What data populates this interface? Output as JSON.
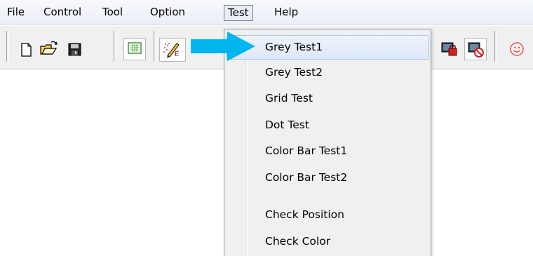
{
  "menubar": {
    "items": [
      {
        "label": "File"
      },
      {
        "label": "Control"
      },
      {
        "label": "Tool"
      },
      {
        "label": "Option"
      },
      {
        "label": "Test"
      },
      {
        "label": "Help"
      }
    ],
    "active": "Test"
  },
  "toolbar": {
    "buttons": [
      {
        "icon": "new-document-icon"
      },
      {
        "icon": "open-folder-icon"
      },
      {
        "icon": "save-disk-icon"
      },
      {
        "icon": "grid-screen-icon"
      },
      {
        "icon": "edit-pencil-icon"
      },
      {
        "icon": "monitor-lock-icon"
      },
      {
        "icon": "monitor-no-icon"
      },
      {
        "icon": "smiley-icon"
      }
    ]
  },
  "test_menu": {
    "items": [
      {
        "label": "Grey Test1",
        "highlighted": true
      },
      {
        "label": "Grey Test2"
      },
      {
        "label": "Grid Test"
      },
      {
        "label": "Dot Test"
      },
      {
        "label": "Color Bar Test1"
      },
      {
        "label": "Color Bar Test2"
      },
      {
        "label": "Check Position"
      },
      {
        "label": "Check Color"
      }
    ]
  },
  "annotation": {
    "icon": "pointer-arrow-icon",
    "color": "#00b6f0"
  },
  "colors": {
    "menu_highlight_border": "#a8c5ea",
    "toolbar_background": "#f0f0f0"
  }
}
